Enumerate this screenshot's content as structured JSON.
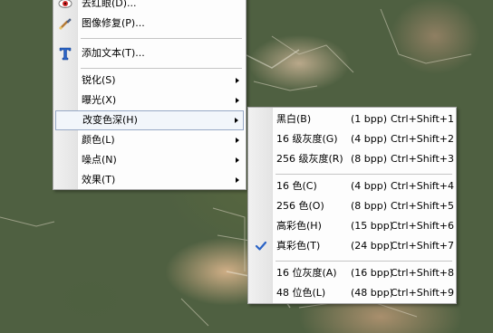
{
  "main_menu": {
    "items": [
      {
        "label": "去红眼(D)...",
        "icon": "red-eye-icon"
      },
      {
        "label": "图像修复(P)...",
        "icon": "repair-brush-icon"
      },
      {
        "label": "添加文本(T)...",
        "icon": "text-t-icon"
      },
      {
        "label": "锐化(S)",
        "submenu": true
      },
      {
        "label": "曝光(X)",
        "submenu": true
      },
      {
        "label": "改变色深(H)",
        "submenu": true,
        "selected": true
      },
      {
        "label": "颜色(L)",
        "submenu": true
      },
      {
        "label": "噪点(N)",
        "submenu": true
      },
      {
        "label": "效果(T)",
        "submenu": true
      }
    ]
  },
  "color_depth_menu": {
    "items": [
      {
        "label": "黑白(B)",
        "bpp": "(1 bpp)",
        "shortcut": "Ctrl+Shift+1"
      },
      {
        "label": "16 级灰度(G)",
        "bpp": "(4 bpp)",
        "shortcut": "Ctrl+Shift+2"
      },
      {
        "label": "256 级灰度(R)",
        "bpp": "(8 bpp)",
        "shortcut": "Ctrl+Shift+3"
      },
      {
        "label": "16 色(C)",
        "bpp": "(4 bpp)",
        "shortcut": "Ctrl+Shift+4"
      },
      {
        "label": "256 色(O)",
        "bpp": "(8 bpp)",
        "shortcut": "Ctrl+Shift+5"
      },
      {
        "label": "高彩色(H)",
        "bpp": "(15 bpp)",
        "shortcut": "Ctrl+Shift+6"
      },
      {
        "label": "真彩色(T)",
        "bpp": "(24 bpp)",
        "shortcut": "Ctrl+Shift+7",
        "checked": true
      },
      {
        "label": "16 位灰度(A)",
        "bpp": "(16 bpp)",
        "shortcut": "Ctrl+Shift+8"
      },
      {
        "label": "48 位色(L)",
        "bpp": "(48 bpp)",
        "shortcut": "Ctrl+Shift+9"
      }
    ]
  },
  "colors": {
    "menu_bg": "#fdfdfd",
    "selection_border": "#97a9c5",
    "check_blue": "#2a63c6"
  }
}
